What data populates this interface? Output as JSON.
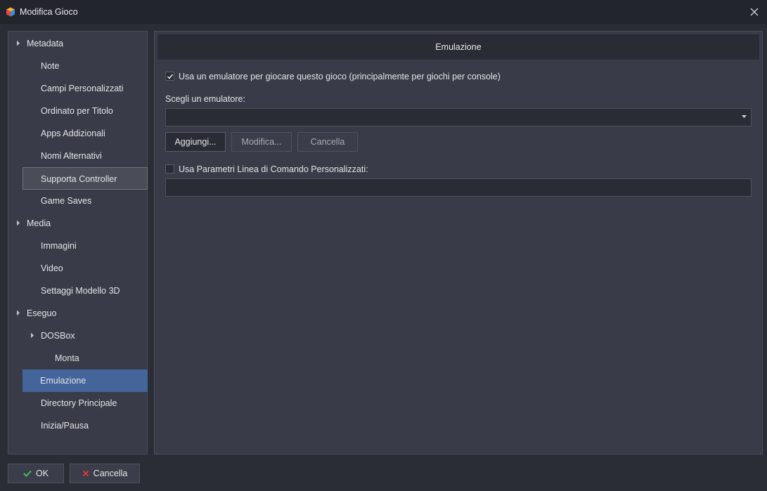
{
  "window": {
    "title": "Modifica Gioco",
    "app_icon": "launchbox-cube-icon",
    "close_icon": "close-icon"
  },
  "sidebar": {
    "items": [
      {
        "label": "Metadata",
        "level": 0,
        "expandable": true
      },
      {
        "label": "Note",
        "level": 1
      },
      {
        "label": "Campi Personalizzati",
        "level": 1
      },
      {
        "label": "Ordinato per Titolo",
        "level": 1
      },
      {
        "label": "Apps Addizionali",
        "level": 1
      },
      {
        "label": "Nomi Alternativi",
        "level": 1
      },
      {
        "label": "Supporta Controller",
        "level": 1,
        "state": "hover"
      },
      {
        "label": "Game Saves",
        "level": 1
      },
      {
        "label": "Media",
        "level": 0,
        "expandable": true
      },
      {
        "label": "Immagini",
        "level": 1
      },
      {
        "label": "Video",
        "level": 1
      },
      {
        "label": "Settaggi Modello 3D",
        "level": 1
      },
      {
        "label": "Eseguo",
        "level": 0,
        "expandable": true
      },
      {
        "label": "DOSBox",
        "level": 1,
        "expandable": true
      },
      {
        "label": "Monta",
        "level": 2
      },
      {
        "label": "Emulazione",
        "level": 1,
        "state": "selected"
      },
      {
        "label": "Directory Principale",
        "level": 1
      },
      {
        "label": "Inizia/Pausa",
        "level": 1
      }
    ]
  },
  "content": {
    "header": "Emulazione",
    "use_emulator": {
      "label": "Usa un emulatore per giocare questo gioco (principalmente per giochi per console)",
      "checked": true
    },
    "choose_emulator_label": "Scegli un emulatore:",
    "emulator_select": {
      "value": ""
    },
    "buttons": {
      "add": "Aggiungi...",
      "edit": "Modifica...",
      "delete": "Cancella"
    },
    "custom_cmd": {
      "label": "Usa Parametri Linea di Comando Personalizzati:",
      "checked": false
    },
    "custom_cmd_input": {
      "value": ""
    }
  },
  "footer": {
    "ok": {
      "label": "OK",
      "icon": "checkmark-icon"
    },
    "cancel": {
      "label": "Cancella",
      "icon": "cancel-x-icon"
    }
  },
  "colors": {
    "background": "#2b2d36",
    "panel": "#393c48",
    "selected": "#44659a",
    "ok_green": "#3cc25a",
    "cancel_red": "#d9363e"
  }
}
